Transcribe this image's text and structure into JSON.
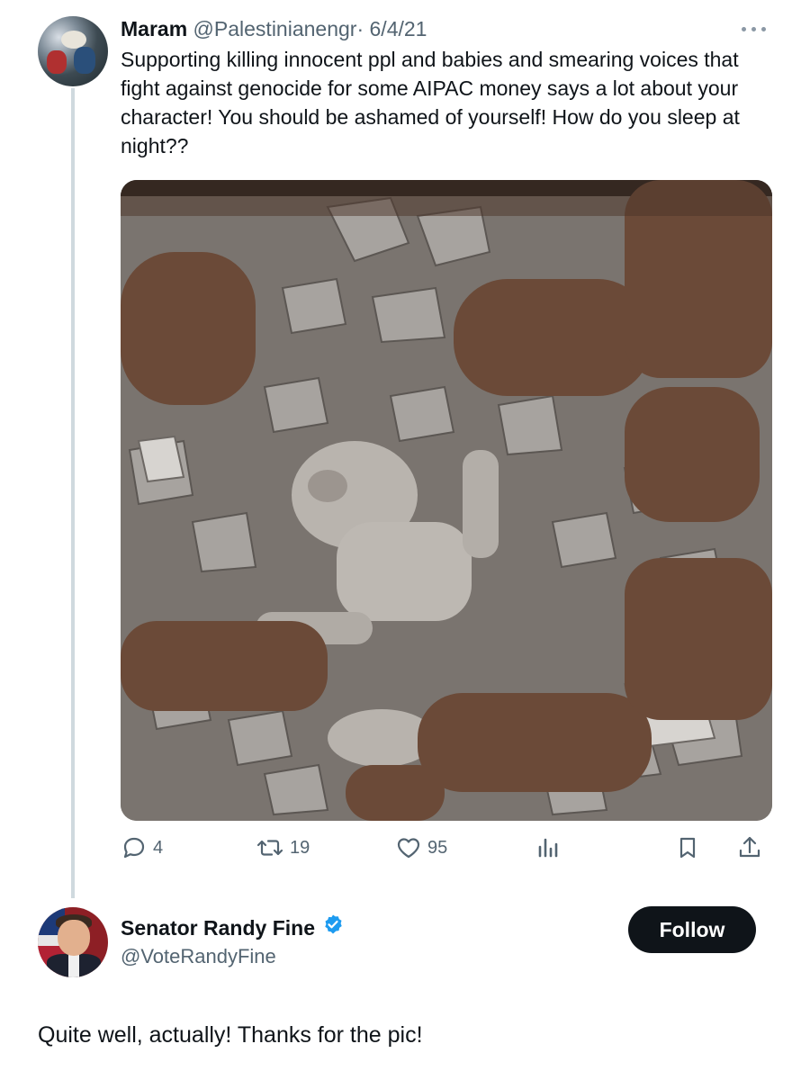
{
  "original_tweet": {
    "author_name": "Maram",
    "author_handle": "@Palestinianengr",
    "separator": "·",
    "date": "6/4/21",
    "text": "Supporting killing innocent ppl and babies and smearing voices that fight against genocide for some AIPAC money says a lot about your character! You should be ashamed of yourself! How do you sleep at night??",
    "media_icon": "photo",
    "actions": {
      "replies": "4",
      "reposts": "19",
      "likes": "95"
    }
  },
  "reply_tweet": {
    "author_name": "Senator Randy Fine",
    "author_handle": "@VoteRandyFine",
    "verified": true,
    "follow_label": "Follow",
    "text": "Quite well, actually!  Thanks for the pic!"
  },
  "colors": {
    "muted": "#536471",
    "verified": "#1d9bf0",
    "button_bg": "#0f1419",
    "thread_line": "#cfd9de"
  }
}
